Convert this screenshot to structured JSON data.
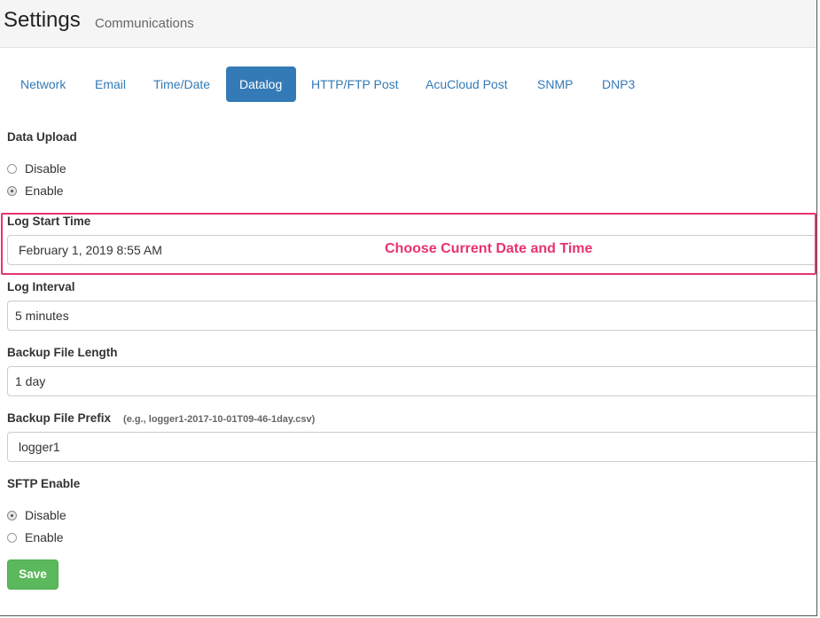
{
  "header": {
    "title": "Settings",
    "subtitle": "Communications"
  },
  "tabs": [
    {
      "label": "Network"
    },
    {
      "label": "Email"
    },
    {
      "label": "Time/Date"
    },
    {
      "label": "Datalog",
      "active": true
    },
    {
      "label": "HTTP/FTP Post"
    },
    {
      "label": "AcuCloud Post"
    },
    {
      "label": "SNMP"
    },
    {
      "label": "DNP3"
    }
  ],
  "data_upload": {
    "label": "Data Upload",
    "options": [
      {
        "label": "Disable",
        "checked": false
      },
      {
        "label": "Enable",
        "checked": true
      }
    ]
  },
  "log_start_time": {
    "label": "Log Start Time",
    "value": "February 1, 2019 8:55 AM",
    "annotation": "Choose Current Date and Time"
  },
  "log_interval": {
    "label": "Log Interval",
    "value": "5 minutes"
  },
  "backup_file_length": {
    "label": "Backup File Length",
    "value": "1 day"
  },
  "backup_file_prefix": {
    "label": "Backup File Prefix",
    "hint": "(e.g., logger1-2017-10-01T09-46-1day.csv)",
    "value": "logger1"
  },
  "sftp_enable": {
    "label": "SFTP Enable",
    "options": [
      {
        "label": "Disable",
        "checked": true
      },
      {
        "label": "Enable",
        "checked": false
      }
    ]
  },
  "save_label": "Save",
  "colors": {
    "tab_active_bg": "#337ab7",
    "link": "#337ab7",
    "save_bg": "#5cb85c",
    "annotation": "#e8336d"
  }
}
